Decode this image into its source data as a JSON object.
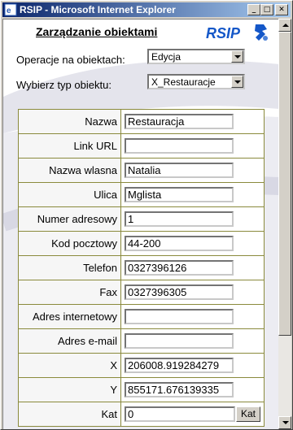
{
  "window": {
    "title": "RSIP - Microsoft Internet Explorer",
    "minimize_glyph": "_",
    "maximize_glyph": "□",
    "close_glyph": "✕"
  },
  "header": {
    "title": "Zarządzanie obiektami",
    "logo_text": "RSIP"
  },
  "controls": {
    "operations_label": "Operacje na obiektach:",
    "operations_value": "Edycja",
    "object_type_label": "Wybierz typ obiektu:",
    "object_type_value": "X_Restauracje"
  },
  "form": {
    "rows": [
      {
        "label": "Nazwa",
        "value": "Restauracja"
      },
      {
        "label": "Link URL",
        "value": ""
      },
      {
        "label": "Nazwa wlasna",
        "value": "Natalia"
      },
      {
        "label": "Ulica",
        "value": "Mglista"
      },
      {
        "label": "Numer adresowy",
        "value": "1"
      },
      {
        "label": "Kod pocztowy",
        "value": "44-200"
      },
      {
        "label": "Telefon",
        "value": "0327396126"
      },
      {
        "label": "Fax",
        "value": "0327396305"
      },
      {
        "label": "Adres internetowy",
        "value": ""
      },
      {
        "label": "Adres e-mail",
        "value": ""
      },
      {
        "label": "X",
        "value": "206008.919284279"
      },
      {
        "label": "Y",
        "value": "855171.676139335"
      },
      {
        "label": "Kat",
        "value": "0",
        "button": "Kat"
      }
    ]
  },
  "colors": {
    "titlebar_start": "#0a246a",
    "titlebar_end": "#a6caf0",
    "logo_blue": "#1457c8",
    "table_border": "#8a8a3c"
  }
}
